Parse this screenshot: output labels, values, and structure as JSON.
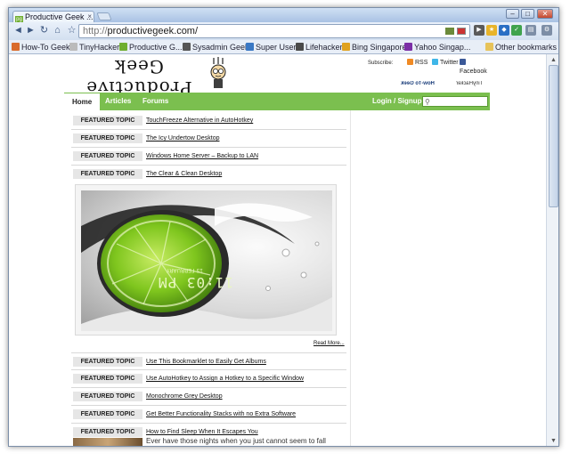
{
  "browser": {
    "tab_title": "Productive Geek ...",
    "tab_favicon": "pg",
    "tab_close": "×",
    "window_controls": [
      "–",
      "□",
      "✕"
    ],
    "toolbar": {
      "back_icon": "◄",
      "forward_icon": "►",
      "reload_icon": "↻",
      "home_icon": "⌂",
      "star_icon": "☆",
      "url_protocol": "http://",
      "url_host": "productivegeek.com/"
    },
    "bookmarks": [
      {
        "label": "How-To Geek",
        "color": "#d96b2c"
      },
      {
        "label": "TinyHacker",
        "color": "#999999"
      },
      {
        "label": "Productive G...",
        "color": "#6fae2f"
      },
      {
        "label": "Sysadmin Geek",
        "color": "#555555"
      },
      {
        "label": "Super User",
        "color": "#3a78c4"
      },
      {
        "label": "Lifehacker",
        "color": "#4a4a4a"
      },
      {
        "label": "Bing Singapore",
        "color": "#e0a21f"
      },
      {
        "label": "Yahoo Singap...",
        "color": "#7b2fa6"
      }
    ],
    "other_bookmarks": "Other bookmarks"
  },
  "site": {
    "logo_text": "Productive Geek",
    "subscribe_label": "Subscribe:",
    "subscribe_links": [
      {
        "label": "RSS",
        "color": "#f08a24"
      },
      {
        "label": "Twitter",
        "color": "#3fb6e8"
      },
      {
        "label": "Facebook",
        "color": "#3b5998"
      }
    ],
    "partner_howtogeek": "How-To Geek",
    "partner_tinyhacker": "TinyHacker",
    "nav": {
      "items": [
        "Home",
        "Articles",
        "Forums"
      ],
      "login": "Login / Signup",
      "search_icon": "🔍"
    },
    "featured_label": "FEATURED TOPIC",
    "topics_top": [
      "TouchFreeze Alternative in AutoHotkey",
      "The Icy Undertow Desktop",
      "Windows Home Server – Backup to LAN",
      "The Clear & Clean Desktop"
    ],
    "image_clock": "11:03 PM",
    "image_date": "15 FEBRUARY",
    "read_more": "Read More...",
    "topics_bottom": [
      "Use This Bookmarklet to Easily Get Albums",
      "Use AutoHotkey to Assign a Hotkey to a Specific Window",
      "Monochrome Grey Desktop",
      "Get Better Functionality Stacks with no Extra Software",
      "How to Find Sleep When It Escapes You"
    ],
    "excerpt": "Ever have those nights when you just cannot seem to fall asleep? You're tired, you had a full day, and you need your rest in order..."
  },
  "colors": {
    "nav_green": "#7bbf4f",
    "accent_lime": "#7fc61e"
  }
}
